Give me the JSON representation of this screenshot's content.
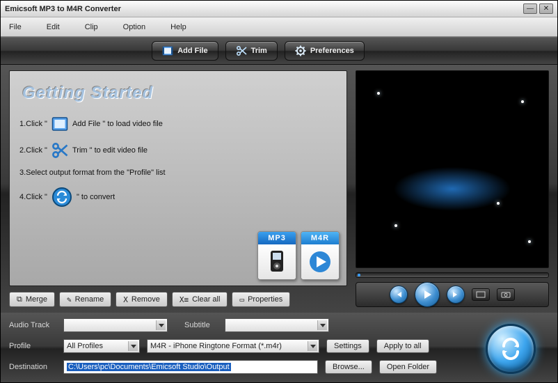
{
  "window": {
    "title": "Emicsoft MP3 to M4R Converter"
  },
  "menu": {
    "file": "File",
    "edit": "Edit",
    "clip": "Clip",
    "option": "Option",
    "help": "Help"
  },
  "toolbar": {
    "add_file": "Add File",
    "trim": "Trim",
    "preferences": "Preferences"
  },
  "getting_started": {
    "title": "Getting Started",
    "step1_a": "1.Click \"",
    "step1_b": "Add File \"  to load video file",
    "step2_a": "2.Click \"",
    "step2_b": "Trim \"  to edit video file",
    "step3": "3.Select output format from the \"Profile\" list",
    "step4_a": "4.Click \"",
    "step4_b": "\"  to convert",
    "badge_mp3": "MP3",
    "badge_m4r": "M4R"
  },
  "file_actions": {
    "merge": "Merge",
    "rename": "Rename",
    "remove": "Remove",
    "clear_all": "Clear all",
    "properties": "Properties"
  },
  "bottom": {
    "audio_track_lbl": "Audio Track",
    "subtitle_lbl": "Subtitle",
    "profile_lbl": "Profile",
    "profile_all": "All Profiles",
    "profile_format": "M4R - iPhone Ringtone Format (*.m4r)",
    "settings": "Settings",
    "apply_all": "Apply to all",
    "destination_lbl": "Destination",
    "destination_val": "C:\\Users\\pc\\Documents\\Emicsoft Studio\\Output",
    "browse": "Browse...",
    "open_folder": "Open Folder"
  }
}
